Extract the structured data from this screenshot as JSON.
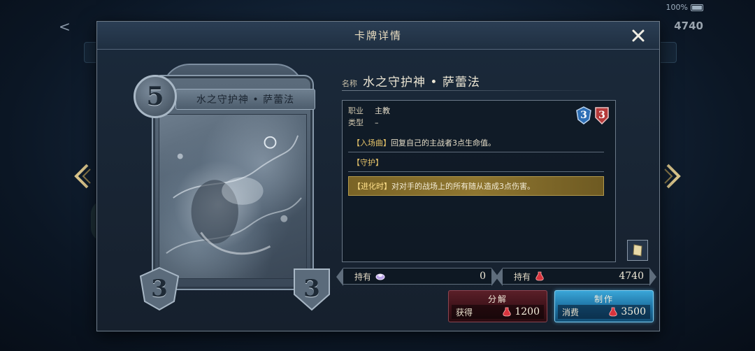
{
  "status_bar": {
    "battery_text": "100%"
  },
  "background": {
    "back_glyph": "<",
    "currency_value": "4740"
  },
  "dialog": {
    "title": "卡牌详情",
    "close_icon": "close-icon"
  },
  "card": {
    "cost": "5",
    "name": "水之守护神 • 萨蕾法",
    "attack": "3",
    "defense": "3"
  },
  "info": {
    "name_label": "名称",
    "name_value": "水之守护神 • 萨蕾法",
    "class_label": "职业",
    "class_value": "主教",
    "type_label": "类型",
    "type_value": "–",
    "badge_attack": "3",
    "badge_defense": "3",
    "abilities": [
      {
        "tag": "【入场曲】",
        "text": "回复自己的主战者3点生命值。"
      },
      {
        "tag": "【守护】",
        "text": ""
      },
      {
        "tag": "【进化时】",
        "text": "对对手的战场上的所有随从造成3点伤害。"
      }
    ]
  },
  "ownership": {
    "left_label": "持有",
    "left_value": "0",
    "right_label": "持有",
    "right_value": "4740"
  },
  "actions": {
    "disenchant": {
      "title": "分解",
      "sub_label": "获得",
      "value": "1200"
    },
    "craft": {
      "title": "制作",
      "sub_label": "消费",
      "value": "3500"
    }
  },
  "colors": {
    "accent_gold": "#e8c56a",
    "craft_blue": "#2a8cc0",
    "disenchant_red": "#5a1f28",
    "badge_blue": "#2e6fb5",
    "badge_red": "#b53a3a"
  }
}
